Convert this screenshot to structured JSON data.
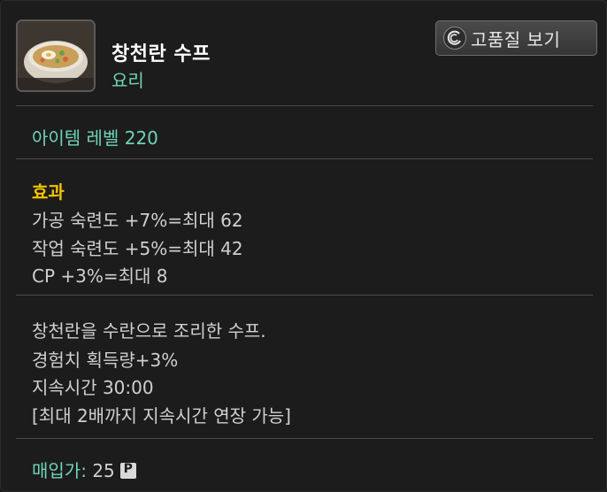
{
  "item": {
    "name": "창천란 수프",
    "type": "요리",
    "icon": "soup-bowl-icon"
  },
  "hq_button": {
    "label": "고품질 보기",
    "icon": "hq-swirl-icon"
  },
  "level": {
    "text": "아이템 레벨 220"
  },
  "effects": {
    "title": "효과",
    "lines": [
      "가공 숙련도 +7%=최대 62",
      "작업 숙련도 +5%=최대 42",
      "CP +3%=최대 8"
    ]
  },
  "description": {
    "lines": [
      "창천란을 수란으로 조리한 수프.",
      "경험치 획득량+3%",
      "지속시간 30:00",
      "[최대 2배까지 지속시간 연장 가능]"
    ]
  },
  "price": {
    "label": "매입가:",
    "value": "25",
    "currency_icon": "gil-coin-icon",
    "currency_glyph": "P"
  },
  "colors": {
    "accent_teal": "#6fd3b8",
    "effect_gold": "#f2c200",
    "text_gray": "#cfcfcf",
    "background": "#1c1c1c"
  }
}
